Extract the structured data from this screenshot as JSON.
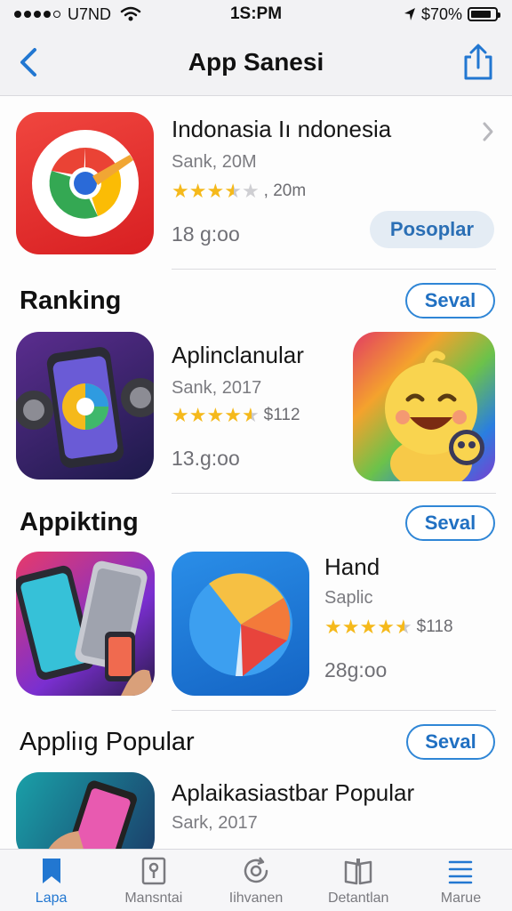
{
  "status_bar": {
    "carrier": "U7ND",
    "time": "1S:PM",
    "battery_text": "$70%",
    "battery_level": 0.85
  },
  "nav": {
    "title": "App Sanesi",
    "back_icon": "chevron-left-icon",
    "share_icon": "share-icon"
  },
  "featured": {
    "title": "Indonasia Iı ndonesia",
    "subtitle": "Sank, 20M",
    "rating_value": 3.5,
    "rating_text": ", 20m",
    "size": "18 g:oo",
    "button": "Posoplar"
  },
  "sections": [
    {
      "title": "Ranking",
      "button": "Seval",
      "app": {
        "title": "Aplinclanular",
        "subtitle": "Sank, 2017",
        "rating_value": 4.5,
        "rating_text": "$112",
        "size": "13.g:oo"
      }
    },
    {
      "title": "Appikting",
      "button": "Seval",
      "app": {
        "title": "Hand",
        "subtitle": "Saplic",
        "rating_value": 4.5,
        "rating_text": "$118",
        "size": "28g:oo"
      }
    },
    {
      "title": "Appliıg Popular",
      "button": "Seval",
      "app": {
        "title": "Aplaikasiastbar Popular",
        "subtitle": "Sark, 2017"
      }
    }
  ],
  "tabs": [
    {
      "label": "Lapa",
      "icon": "bookmark-icon",
      "active": true
    },
    {
      "label": "Mansntai",
      "icon": "map-pin-icon",
      "active": false
    },
    {
      "label": "Iihvanen",
      "icon": "refresh-icon",
      "active": false
    },
    {
      "label": "Detantlan",
      "icon": "book-icon",
      "active": false
    },
    {
      "label": "Marue",
      "icon": "menu-icon",
      "active": false
    }
  ],
  "colors": {
    "accent": "#2277d1",
    "star": "#f5b91b"
  }
}
